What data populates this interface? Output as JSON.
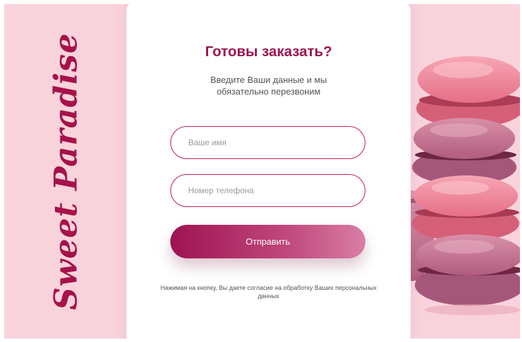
{
  "brand": {
    "name": "Sweet Paradise"
  },
  "form": {
    "title": "Готовы заказать?",
    "subtitle": "Введите Ваши данные и мы обязательно перезвоним",
    "name_placeholder": "Ваше имя",
    "phone_placeholder": "Номер телефона",
    "submit_label": "Отправить",
    "consent_text": "Нажимая на кнопку, Вы даете согласие на обработку Ваших персональных данных"
  },
  "colors": {
    "background": "#f9d3db",
    "accent": "#9c1550",
    "button_gradient_start": "#9e1352",
    "button_gradient_end": "#d87fa5"
  },
  "image": {
    "subject": "stacked-pink-macarons"
  }
}
